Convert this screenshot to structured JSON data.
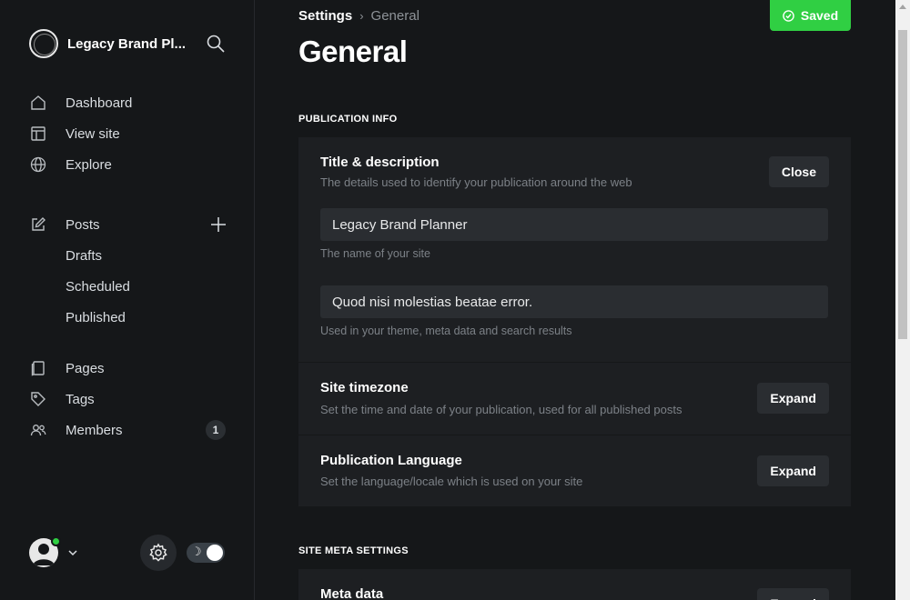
{
  "sidebar": {
    "site_name": "Legacy Brand Pl...",
    "nav_primary": [
      {
        "label": "Dashboard",
        "icon": "home-icon"
      },
      {
        "label": "View site",
        "icon": "layout-icon"
      },
      {
        "label": "Explore",
        "icon": "globe-icon"
      }
    ],
    "posts": {
      "label": "Posts",
      "icon": "edit-icon",
      "sub_items": [
        "Drafts",
        "Scheduled",
        "Published"
      ]
    },
    "nav_secondary": [
      {
        "label": "Pages",
        "icon": "page-icon"
      },
      {
        "label": "Tags",
        "icon": "tag-icon"
      },
      {
        "label": "Members",
        "icon": "members-icon",
        "badge": "1"
      }
    ],
    "theme_icon": "☽"
  },
  "header": {
    "breadcrumb_parent": "Settings",
    "breadcrumb_sep": "›",
    "breadcrumb_current": "General",
    "title": "General",
    "saved_label": "Saved"
  },
  "sections": {
    "publication_info": "PUBLICATION INFO",
    "site_meta": "SITE META SETTINGS"
  },
  "title_description": {
    "title": "Title & description",
    "desc": "The details used to identify your publication around the web",
    "button": "Close",
    "site_title_value": "Legacy Brand Planner",
    "site_title_hint": "The name of your site",
    "site_desc_value": "Quod nisi molestias beatae error.",
    "site_desc_hint": "Used in your theme, meta data and search results"
  },
  "timezone": {
    "title": "Site timezone",
    "desc": "Set the time and date of your publication, used for all published posts",
    "button": "Expand"
  },
  "language": {
    "title": "Publication Language",
    "desc": "Set the language/locale which is used on your site",
    "button": "Expand"
  },
  "meta_data": {
    "title": "Meta data",
    "button": "Expand"
  },
  "colors": {
    "accent_green": "#30cf43",
    "background": "#151719",
    "card": "#1d1f22"
  }
}
